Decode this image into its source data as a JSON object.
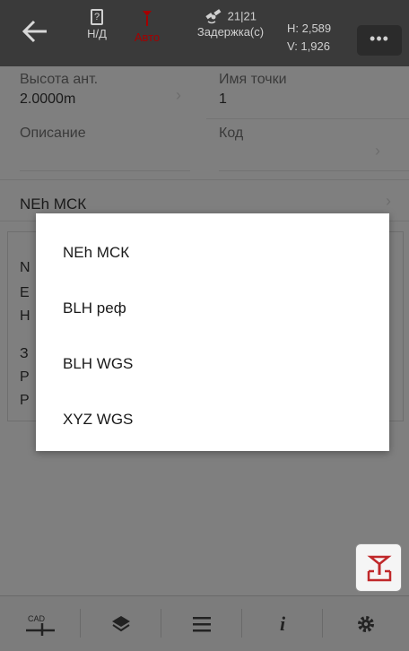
{
  "header": {
    "battery_text": "Н/Д",
    "battery_icon_glyph": "?",
    "rtk_status": "Авто",
    "satellites": "21|21",
    "delay_label": "Задержка(с)",
    "h_value": "H: 2,589",
    "v_value": "V: 1,926",
    "menu_glyph": "•••"
  },
  "fields": {
    "antenna_height_label": "Высота ант.",
    "antenna_height_value": "2.0000m",
    "point_name_label": "Имя точки",
    "point_name_value": "1",
    "description_label": "Описание",
    "code_label": "Код",
    "coord_type_value": "NEh МСК"
  },
  "partial_card_letters": [
    "N",
    "E",
    "H",
    "З",
    "P",
    "P"
  ],
  "dialog": {
    "options": [
      "NEh МСК",
      "BLH реф",
      "BLH WGS",
      "XYZ WGS"
    ]
  },
  "bottom_bar": {
    "cad_label": "CAD",
    "info_glyph": "i"
  },
  "colors": {
    "rtk_status": "#a40000",
    "fab_icon": "#c0282a"
  }
}
